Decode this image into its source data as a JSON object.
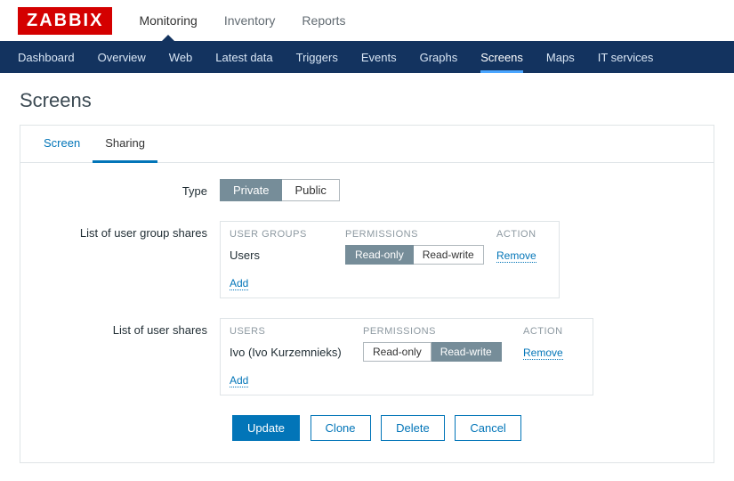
{
  "brand": "ZABBIX",
  "topnav": {
    "items": [
      {
        "label": "Monitoring",
        "active": true
      },
      {
        "label": "Inventory",
        "active": false
      },
      {
        "label": "Reports",
        "active": false
      }
    ]
  },
  "subnav": {
    "items": [
      {
        "label": "Dashboard",
        "active": false
      },
      {
        "label": "Overview",
        "active": false
      },
      {
        "label": "Web",
        "active": false
      },
      {
        "label": "Latest data",
        "active": false
      },
      {
        "label": "Triggers",
        "active": false
      },
      {
        "label": "Events",
        "active": false
      },
      {
        "label": "Graphs",
        "active": false
      },
      {
        "label": "Screens",
        "active": true
      },
      {
        "label": "Maps",
        "active": false
      },
      {
        "label": "IT services",
        "active": false
      }
    ]
  },
  "page_title": "Screens",
  "tabs": [
    {
      "label": "Screen",
      "active": false
    },
    {
      "label": "Sharing",
      "active": true
    }
  ],
  "form": {
    "type_label": "Type",
    "type_options": {
      "private": "Private",
      "public": "Public",
      "selected": "private"
    },
    "group_shares": {
      "label": "List of user group shares",
      "head_name": "USER GROUPS",
      "head_perm": "PERMISSIONS",
      "head_action": "ACTION",
      "rows": [
        {
          "name": "Users",
          "perm_readonly": "Read-only",
          "perm_readwrite": "Read-write",
          "selected": "readonly",
          "action": "Remove"
        }
      ],
      "add_label": "Add"
    },
    "user_shares": {
      "label": "List of user shares",
      "head_name": "USERS",
      "head_perm": "PERMISSIONS",
      "head_action": "ACTION",
      "rows": [
        {
          "name": "Ivo (Ivo Kurzemnieks)",
          "perm_readonly": "Read-only",
          "perm_readwrite": "Read-write",
          "selected": "readwrite",
          "action": "Remove"
        }
      ],
      "add_label": "Add"
    }
  },
  "actions": {
    "update": "Update",
    "clone": "Clone",
    "delete": "Delete",
    "cancel": "Cancel"
  }
}
